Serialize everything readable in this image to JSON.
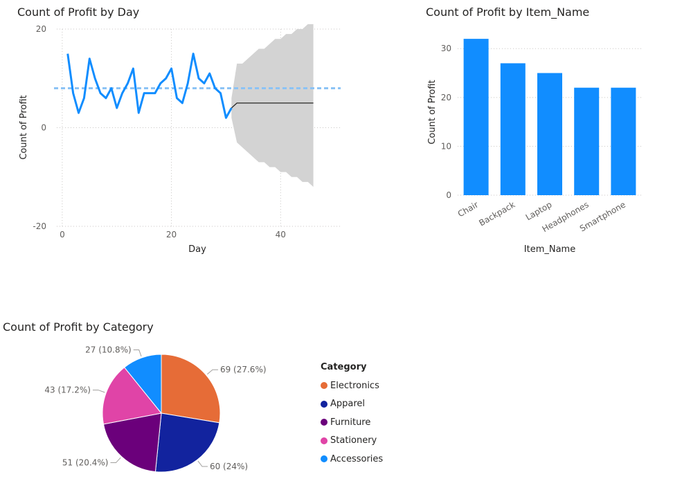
{
  "chart_data": [
    {
      "type": "line",
      "title": "Count of Profit by Day",
      "xlabel": "Day",
      "ylabel": "Count of Profit",
      "xlim": [
        -1,
        51
      ],
      "ylim": [
        -20,
        20
      ],
      "xticks": [
        0,
        20,
        40
      ],
      "yticks": [
        -20,
        0,
        20
      ],
      "tick_labels_x": [
        "0",
        "20",
        "40"
      ],
      "tick_labels_y": [
        "-20",
        "0",
        "20"
      ],
      "grid": true,
      "series": [
        {
          "color": "#118DFF",
          "x": [
            1,
            2,
            3,
            4,
            5,
            6,
            7,
            8,
            9,
            10,
            11,
            12,
            13,
            14,
            15,
            16,
            17,
            18,
            19,
            20,
            21,
            22,
            23,
            24,
            25,
            26,
            27,
            28,
            29,
            30,
            31
          ],
          "y": [
            15,
            7,
            3,
            6,
            14,
            10,
            7,
            6,
            8,
            4,
            7,
            9,
            12,
            3,
            7,
            7,
            7,
            9,
            10,
            12,
            6,
            5,
            9,
            15,
            10,
            9,
            11,
            8,
            7,
            2,
            4
          ]
        }
      ],
      "reference_line": {
        "type": "average",
        "value": 8,
        "color": "#118DFF",
        "style": "dashed"
      },
      "forecast": {
        "color": "#252423",
        "band_color": "#d3d3d3",
        "x": [
          31,
          32,
          33,
          34,
          35,
          36,
          37,
          38,
          39,
          40,
          41,
          42,
          43,
          44,
          45,
          46
        ],
        "y": [
          4,
          5,
          5,
          5,
          5,
          5,
          5,
          5,
          5,
          5,
          5,
          5,
          5,
          5,
          5,
          5
        ],
        "upper": [
          6,
          13,
          13,
          14,
          15,
          16,
          16,
          17,
          18,
          18,
          19,
          19,
          20,
          20,
          21,
          21
        ],
        "lower": [
          2,
          -3,
          -4,
          -5,
          -6,
          -7,
          -7,
          -8,
          -8,
          -9,
          -9,
          -10,
          -10,
          -11,
          -11,
          -12
        ]
      }
    },
    {
      "type": "bar",
      "title": "Count of Profit by Item_Name",
      "xlabel": "Item_Name",
      "ylabel": "Count of Profit",
      "categories": [
        "Chair",
        "Backpack",
        "Laptop",
        "Headphones",
        "Smartphone"
      ],
      "values": [
        32,
        27,
        25,
        22,
        22
      ],
      "ylim": [
        0,
        34
      ],
      "yticks": [
        0,
        10,
        20,
        30
      ],
      "tick_labels_y": [
        "0",
        "10",
        "20",
        "30"
      ],
      "color": "#118DFF",
      "grid": true
    },
    {
      "type": "pie",
      "title": "Count of Profit by Category",
      "legend_title": "Category",
      "legend_position": "right",
      "slices": [
        {
          "label": "Electronics",
          "value": 69,
          "data_label": "69 (27.6%)",
          "color": "#E66C37"
        },
        {
          "label": "Apparel",
          "value": 60,
          "data_label": "60 (24%)",
          "color": "#12239E"
        },
        {
          "label": "Furniture",
          "value": 51,
          "data_label": "51 (20.4%)",
          "color": "#6B007B"
        },
        {
          "label": "Stationery",
          "value": 43,
          "data_label": "43 (17.2%)",
          "color": "#E044A7"
        },
        {
          "label": "Accessories",
          "value": 27,
          "data_label": "27 (10.8%)",
          "color": "#118DFF"
        }
      ]
    }
  ]
}
